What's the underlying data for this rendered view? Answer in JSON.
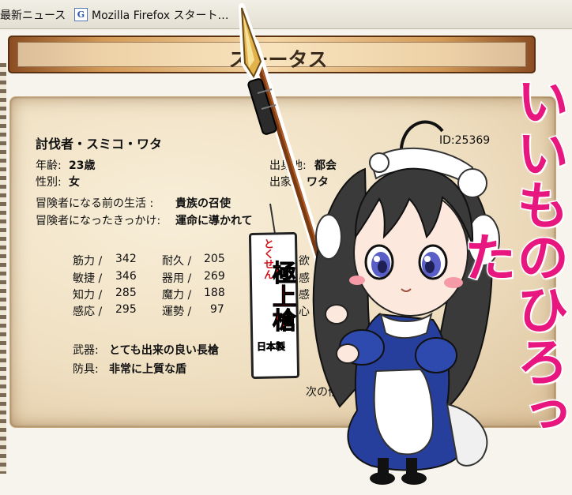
{
  "browser": {
    "bookmarks": [
      {
        "label": "最新ニュース"
      },
      {
        "label": "Mozilla Firefox スタート…",
        "icon": "google-g-icon",
        "icon_glyph": "G"
      }
    ]
  },
  "panel": {
    "title": "スーータス",
    "character_name": "討伐者・スミコ・ワタ",
    "id_label": "ID:25369",
    "profile_left": [
      {
        "label": "年齢:",
        "value": "23歳"
      },
      {
        "label": "性別:",
        "value": "女"
      }
    ],
    "profile_right": [
      {
        "label": "出身地:",
        "value": "都会"
      },
      {
        "label": "出家:",
        "value": "ワタ"
      }
    ],
    "background": [
      {
        "label": "冒険者になる前の生活 :",
        "value": "貴族の召使"
      },
      {
        "label": "冒険者になったきっかけ:",
        "value": "運命に導かれて"
      }
    ],
    "stats": [
      {
        "label": "筋力 /",
        "value": "342"
      },
      {
        "label": "耐久 /",
        "value": "205"
      },
      {
        "label": "敏捷 /",
        "value": "346"
      },
      {
        "label": "器用 /",
        "value": "269"
      },
      {
        "label": "知力 /",
        "value": "285"
      },
      {
        "label": "魔力 /",
        "value": "188"
      },
      {
        "label": "感応 /",
        "value": "295"
      },
      {
        "label": "運勢 /",
        "value": "97"
      }
    ],
    "partial_right": [
      "欲",
      "皆",
      "感",
      "感",
      "心"
    ],
    "equipment": [
      {
        "label": "武器:",
        "value": "とても出来の良い長槍"
      },
      {
        "label": "防具:",
        "value": "非常に上質な盾"
      }
    ],
    "footer_partial": "次の依"
  },
  "overlay": {
    "caption": "いいものひろった",
    "caption_color": "#e8177f",
    "tag": {
      "top": "とくせん",
      "main": "極上槍",
      "bottom": "日本製",
      "color": "#d0141b"
    }
  },
  "colors": {
    "banner": "#c98a45",
    "parchment": "#f1e4c8"
  }
}
